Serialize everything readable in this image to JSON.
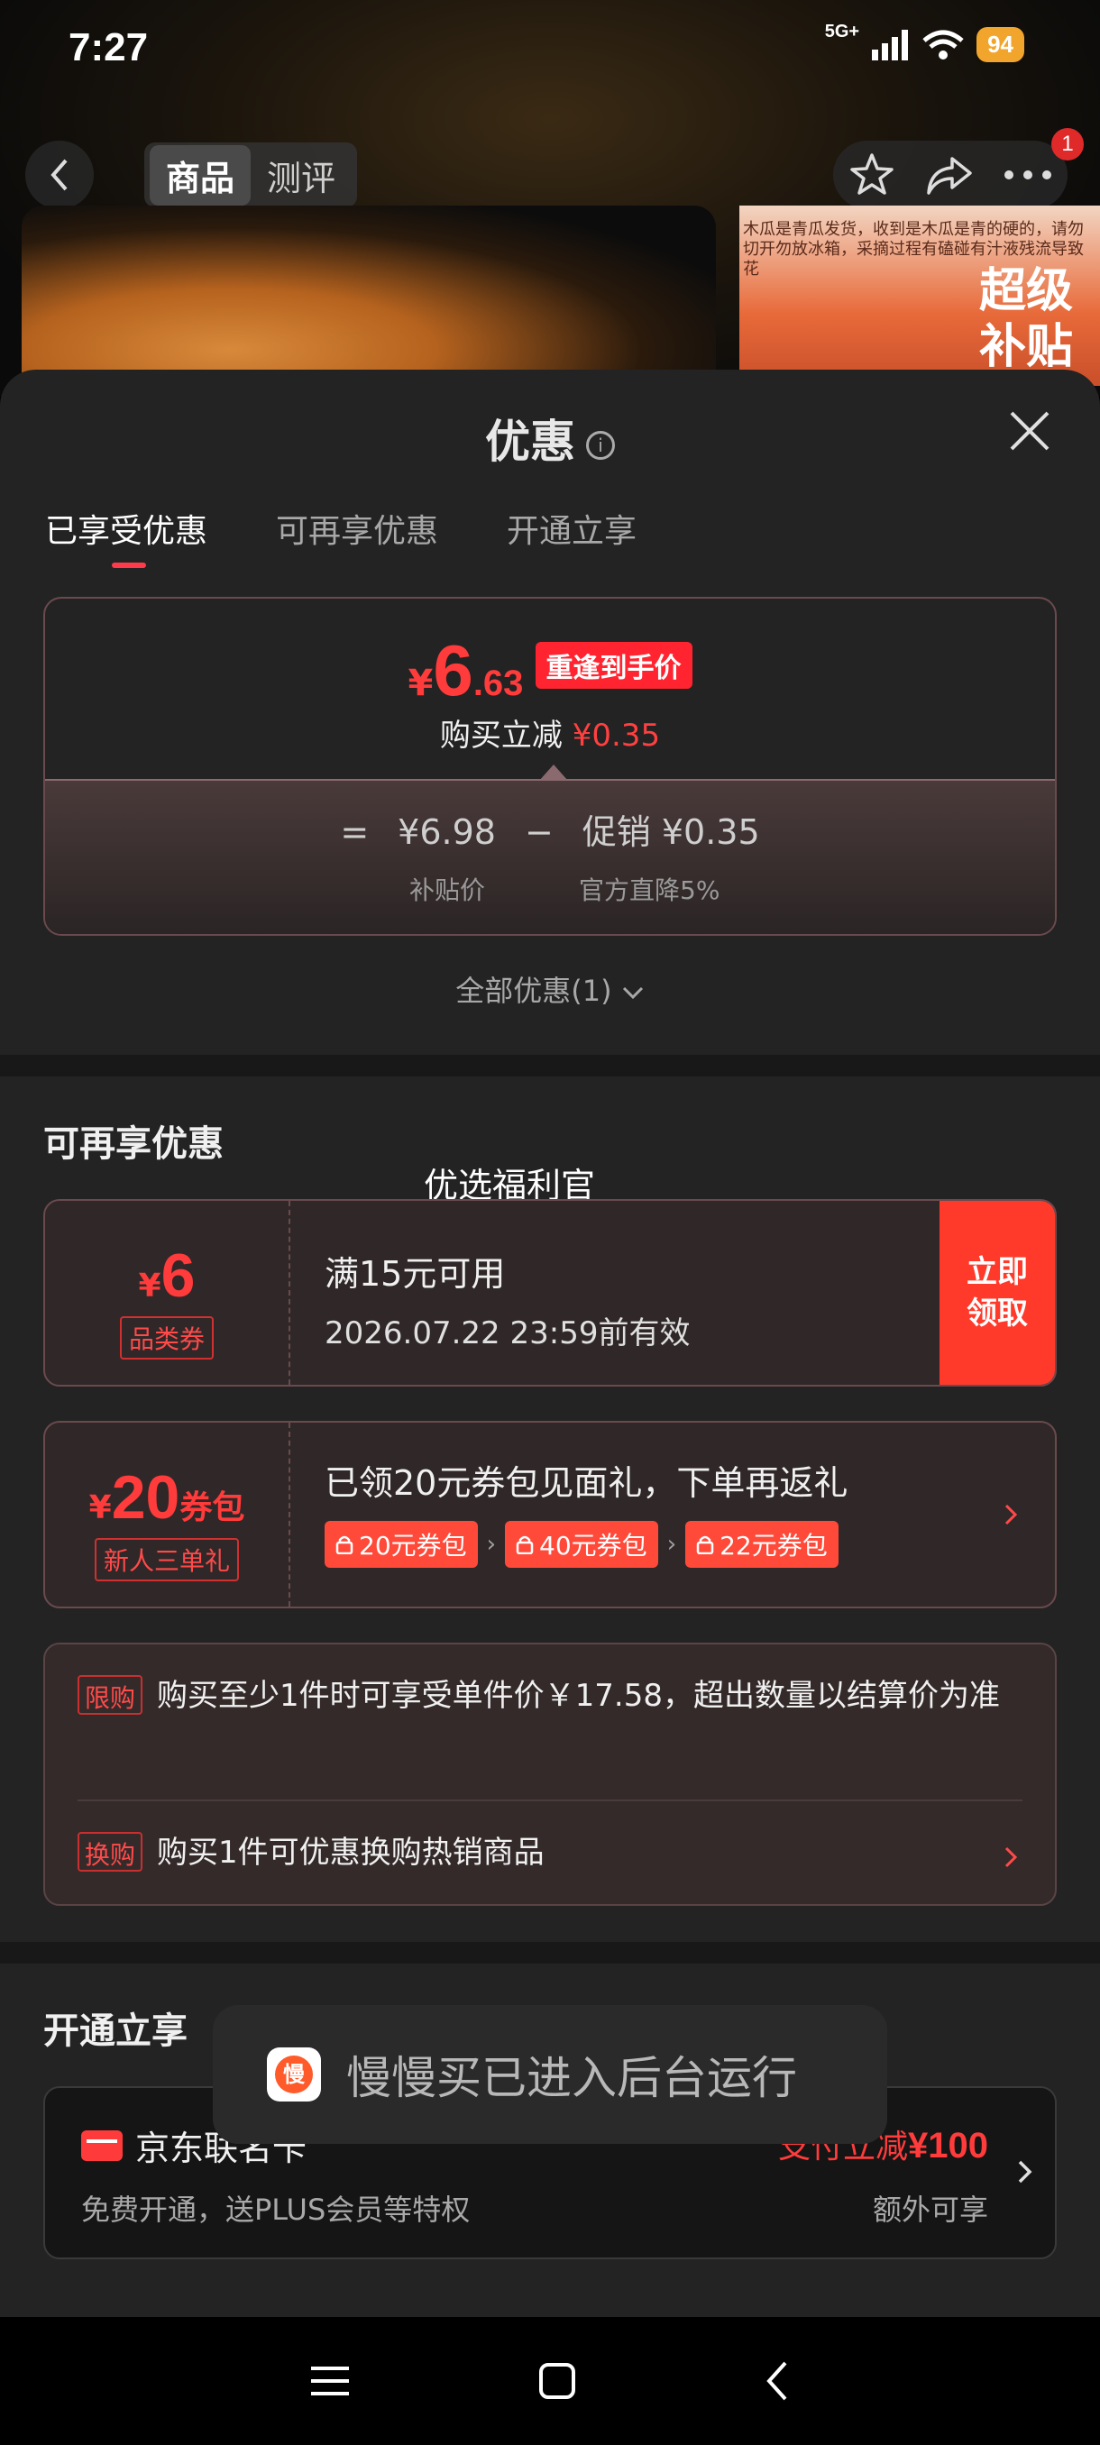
{
  "status": {
    "time": "7:27",
    "network": "5G+",
    "battery": "94"
  },
  "nav": {
    "tabs": [
      "商品",
      "测评"
    ],
    "badge_count": "1"
  },
  "product": {
    "note": "木瓜是青瓜发货，收到是木瓜是青的硬的，请勿切开勿放冰箱，采摘过程有磕碰有汁液残流导致花",
    "promo": "超级补贴"
  },
  "sheet": {
    "title": "优惠",
    "tabs": [
      "已享受优惠",
      "可再享优惠",
      "开通立享"
    ],
    "summary": {
      "yen": "¥",
      "price_int": "6",
      "price_dec": ".63",
      "tag": "重逢到手价",
      "sub_label": "购买立减",
      "sub_value": "¥0.35",
      "eq": "=",
      "base_price": "¥6.98",
      "minus": "−",
      "promo_part": "促销 ¥0.35",
      "base_label": "补贴价",
      "promo_label": "官方直降5%"
    },
    "all_offers": "全部优惠(1)"
  },
  "more_offers": {
    "title": "可再享优惠",
    "floating_label": "优选福利官",
    "coupon1": {
      "yen": "¥",
      "amount": "6",
      "badge": "品类券",
      "title": "满15元可用",
      "expiry": "2026.07.22 23:59前有效",
      "claim": "立即领取"
    },
    "coupon2": {
      "yen": "¥",
      "amount": "20",
      "unit": "券包",
      "badge": "新人三单礼",
      "title": "已领20元券包见面礼，下单再返礼",
      "chips": [
        "20元券包",
        "40元券包",
        "22元券包"
      ]
    },
    "rules": [
      {
        "tag": "限购",
        "text": "购买至少1件时可享受单件价￥17.58，超出数量以结算价为准"
      },
      {
        "tag": "换购",
        "text": "购买1件可优惠换购热销商品"
      }
    ]
  },
  "open_section": {
    "title": "开通立享",
    "card_name": "京东联名卡",
    "card_desc": "免费开通，送PLUS会员等特权",
    "right_label": "支付立减",
    "right_amount": "¥100",
    "right_sub": "额外可享"
  },
  "toast": {
    "icon_char": "慢",
    "text": "慢慢买已进入后台运行"
  }
}
